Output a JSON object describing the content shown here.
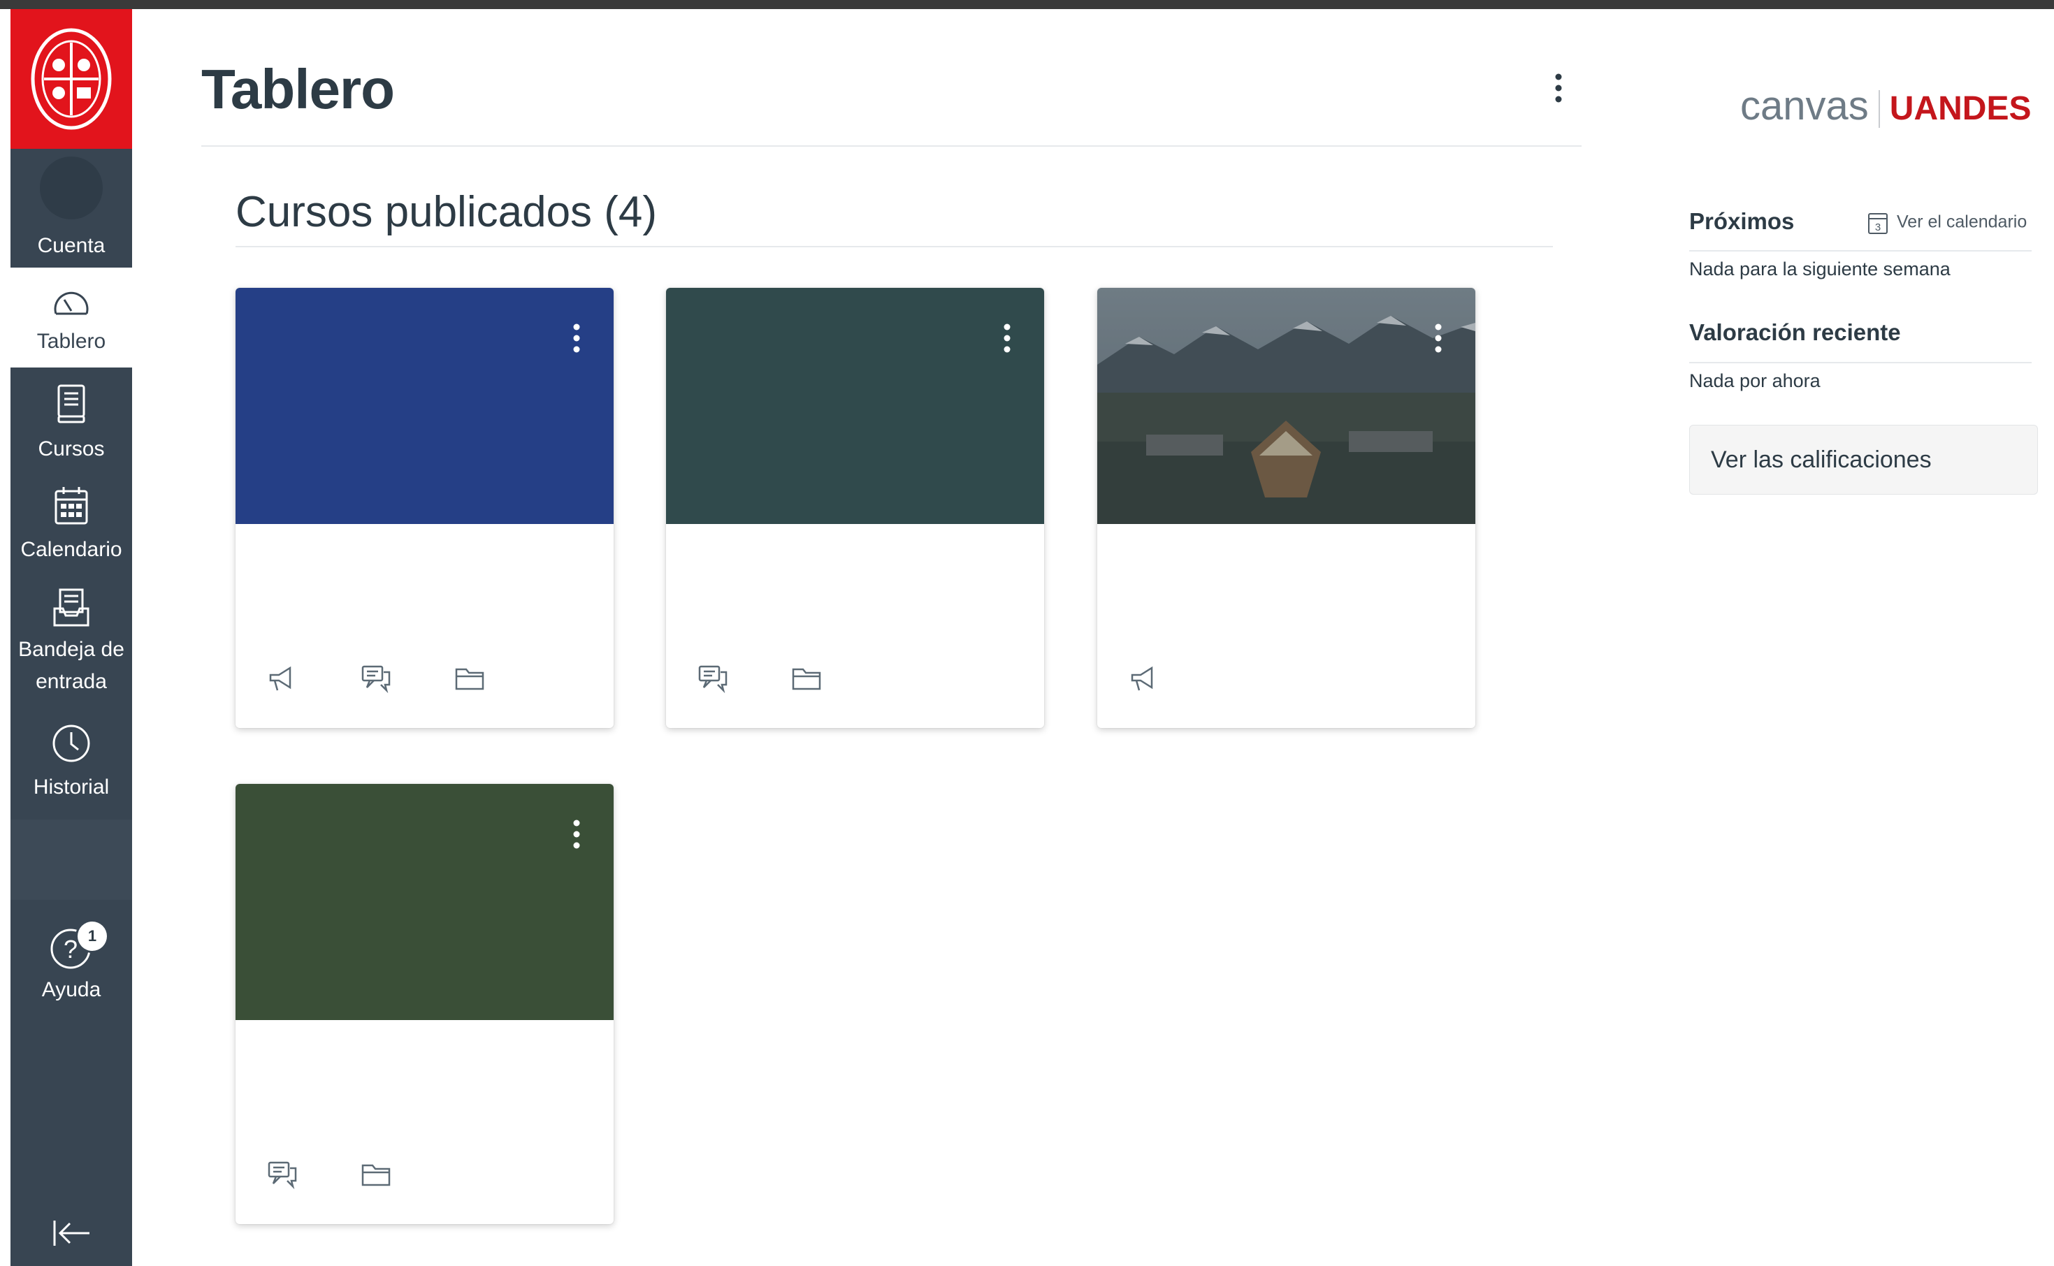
{
  "window": {
    "title": "Tablero"
  },
  "global_nav": {
    "logo": {
      "icon": "university-seal-icon",
      "color": "#e2141c"
    },
    "items": [
      {
        "label": "Cuenta",
        "icon": "avatar-icon"
      },
      {
        "label": "Tablero",
        "icon": "dashboard-gauge-icon",
        "active": true
      },
      {
        "label": "Cursos",
        "icon": "courses-book-icon"
      },
      {
        "label": "Calendario",
        "icon": "calendar-icon"
      },
      {
        "label": "Bandeja de",
        "label2": "entrada",
        "icon": "inbox-icon"
      },
      {
        "label": "Historial",
        "icon": "clock-icon"
      },
      {
        "label": "Ayuda",
        "icon": "help-icon",
        "badge": "1"
      }
    ],
    "collapse_icon": "collapse-arrow-icon"
  },
  "main": {
    "title": "Tablero",
    "section_title": "Cursos publicados (4)",
    "cards": [
      {
        "color": "#253f86",
        "actions": [
          "announcements-icon",
          "discussions-icon",
          "files-icon"
        ]
      },
      {
        "color": "#304a4c",
        "actions": [
          "discussions-icon",
          "files-icon"
        ]
      },
      {
        "color": "#5b6770",
        "image": "campus-aerial-photo",
        "actions": [
          "announcements-icon"
        ]
      },
      {
        "color": "#3a4f37",
        "actions": [
          "discussions-icon",
          "files-icon"
        ]
      }
    ]
  },
  "sidebar": {
    "brand_left": "canvas",
    "brand_right": "UANDES",
    "upcoming": {
      "heading": "Próximos",
      "calendar_link": "Ver el calendario",
      "calendar_day": "3",
      "empty": "Nada para la siguiente semana"
    },
    "recent": {
      "heading": "Valoración reciente",
      "empty": "Nada por ahora"
    },
    "grades_button": "Ver las calificaciones"
  },
  "colors": {
    "nav": "#384552",
    "brand_red": "#e2141c",
    "text": "#2d3b45"
  }
}
